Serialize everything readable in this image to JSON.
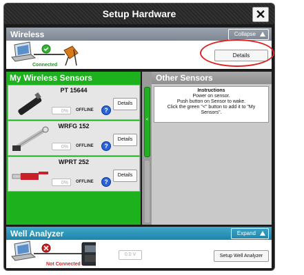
{
  "window": {
    "title": "Setup Hardware",
    "close_glyph": "✕"
  },
  "wireless": {
    "header": "Wireless",
    "toggle_label": "Collapse",
    "status": "Connected",
    "details_label": "Details"
  },
  "my_wireless_sensors": {
    "title": "My Wireless Sensors",
    "sensors": [
      {
        "name": "PT 15644",
        "percent": "0%",
        "status": "OFFLINE",
        "details_label": "Details",
        "help": "?"
      },
      {
        "name": "WRFG 152",
        "percent": "0%",
        "status": "OFFLINE",
        "details_label": "Details",
        "help": "?"
      },
      {
        "name": "WPRT 252",
        "percent": "0%",
        "status": "OFFLINE",
        "details_label": "Details",
        "help": "?"
      }
    ],
    "add_arrow": "<"
  },
  "other_sensors": {
    "title": "Other Sensors",
    "instructions_title": "Instructions",
    "instructions_lines": [
      "Power on sensor.",
      "Push button on Sensor to wake.",
      "Click the green \"<\" button to add it to \"My",
      "Sensors\"."
    ]
  },
  "well_analyzer": {
    "header": "Well Analyzer",
    "toggle_label": "Expand",
    "status": "Not Connected",
    "voltage": "0.0 V",
    "setup_label": "Setup Well Analyzer"
  },
  "colors": {
    "connected_green": "#1db21d",
    "well_blue": "#2a93bb",
    "error_red": "#e02020",
    "offline_gray": "#c9c9c9"
  },
  "icons": [
    "laptop-icon",
    "check-icon",
    "wireless-dongle-icon",
    "error-icon",
    "analyzer-device-icon",
    "help-icon",
    "sensor-probe-icon"
  ]
}
